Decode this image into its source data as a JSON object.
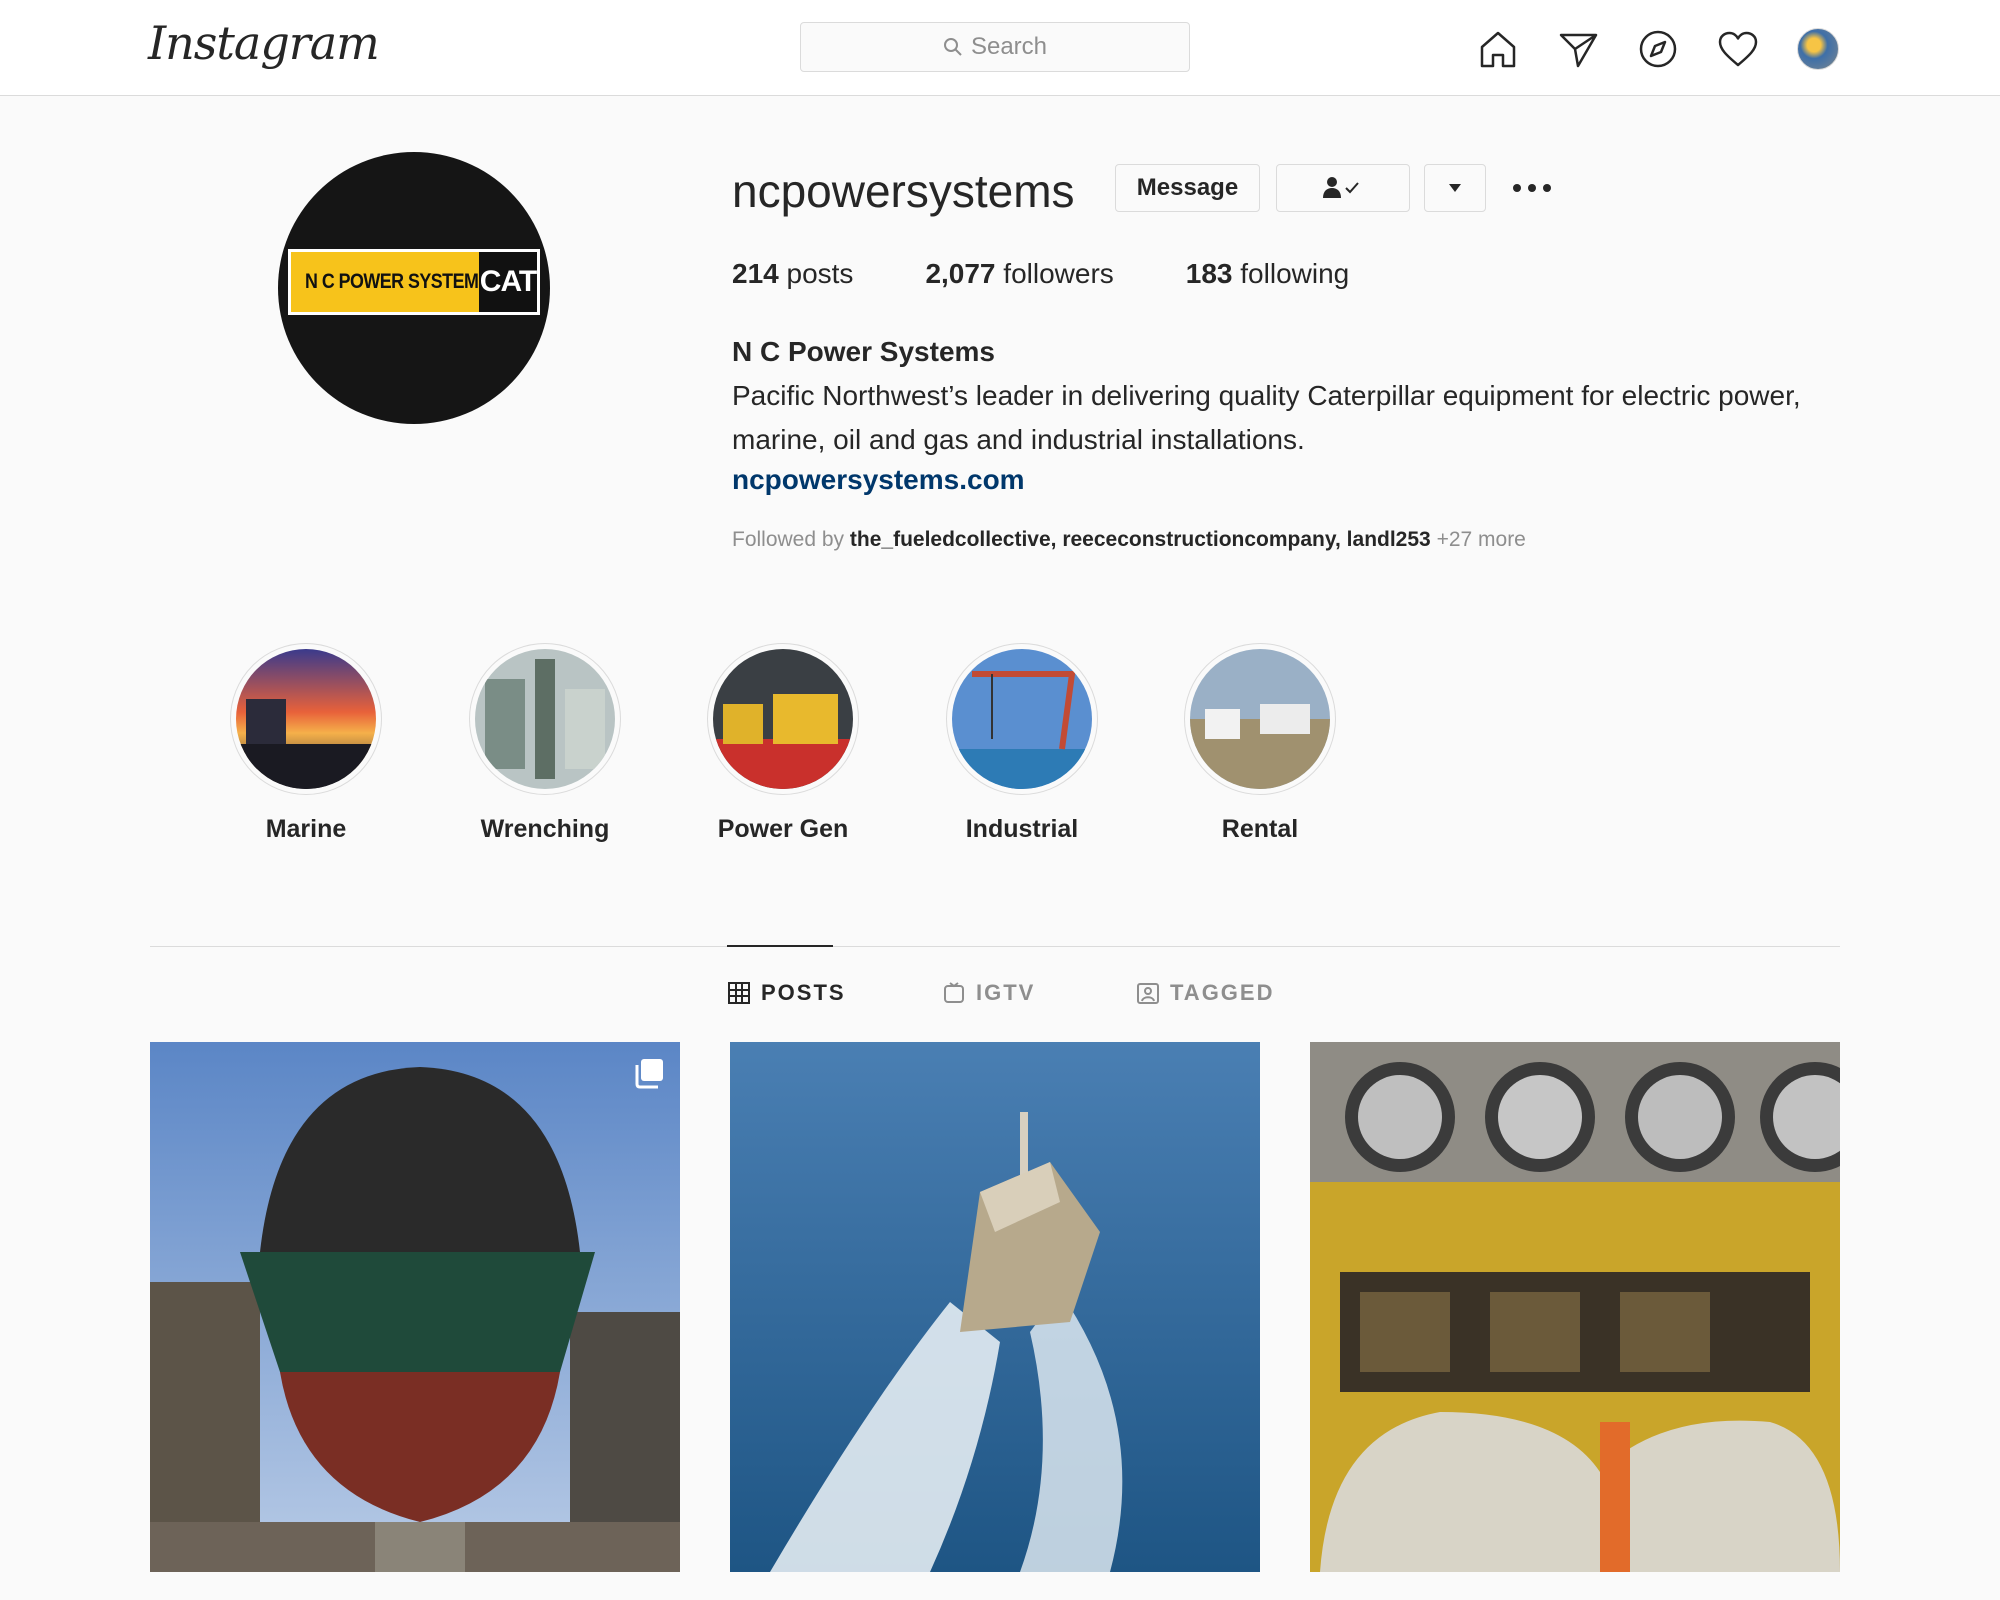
{
  "header": {
    "logo_text": "Instagram",
    "search_placeholder": "Search",
    "icons": [
      "home-icon",
      "direct-message-icon",
      "explore-icon",
      "activity-heart-icon",
      "profile-avatar"
    ]
  },
  "profile": {
    "username": "ncpowersystems",
    "buttons": {
      "message": "Message"
    },
    "logo": {
      "text": "N C POWER SYSTEMS",
      "mark": "CAT"
    },
    "stats": [
      {
        "count": "214",
        "label": "posts"
      },
      {
        "count": "2,077",
        "label": "followers"
      },
      {
        "count": "183",
        "label": "following"
      }
    ],
    "full_name": "N C Power Systems",
    "bio": "Pacific Northwest’s leader in delivering quality Caterpillar equipment for electric power, marine, oil and gas and industrial installations.",
    "website": "ncpowersystems.com",
    "followed_by": {
      "prefix": "Followed by",
      "names": "the_fueledcollective, reececonstructioncompany, landl253",
      "more": "+27 more"
    }
  },
  "highlights": [
    {
      "label": "Marine"
    },
    {
      "label": "Wrenching"
    },
    {
      "label": "Power Gen"
    },
    {
      "label": "Industrial"
    },
    {
      "label": "Rental"
    }
  ],
  "tabs": [
    {
      "label": "POSTS",
      "active": true
    },
    {
      "label": "IGTV",
      "active": false
    },
    {
      "label": "TAGGED",
      "active": false
    }
  ],
  "colors": {
    "link": "#00376b",
    "border": "#dbdbdb",
    "muted": "#8e8e8e",
    "brand_yellow": "#f7c31b"
  }
}
